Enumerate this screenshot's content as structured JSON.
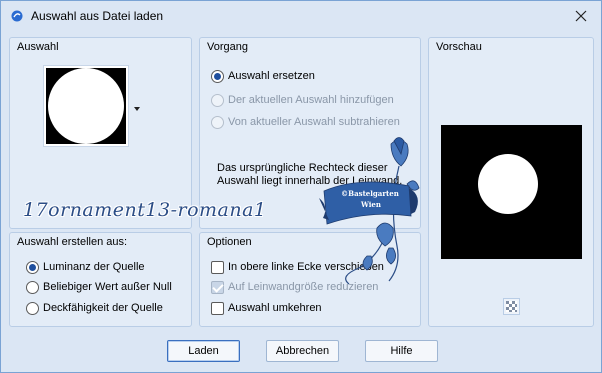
{
  "window": {
    "title": "Auswahl aus Datei laden",
    "close_icon": "close-icon"
  },
  "auswahl": {
    "title": "Auswahl"
  },
  "vorgang": {
    "title": "Vorgang",
    "options": [
      {
        "label": "Auswahl ersetzen",
        "checked": true,
        "disabled": false
      },
      {
        "label": "Der aktuellen Auswahl hinzufügen",
        "checked": false,
        "disabled": true
      },
      {
        "label": "Von aktueller Auswahl subtrahieren",
        "checked": false,
        "disabled": true
      }
    ],
    "info": "Das ursprüngliche Rechteck dieser Auswahl liegt innerhalb der Leinwand."
  },
  "vorschau": {
    "title": "Vorschau",
    "zoom_icon": "checker-icon"
  },
  "erstellen": {
    "title": "Auswahl erstellen aus:",
    "options": [
      {
        "label": "Luminanz der Quelle",
        "checked": true
      },
      {
        "label": "Beliebiger Wert außer Null",
        "checked": false
      },
      {
        "label": "Deckfähigkeit der Quelle",
        "checked": false
      }
    ]
  },
  "optionen": {
    "title": "Optionen",
    "checks": [
      {
        "label": "In obere linke Ecke verschieben",
        "checked": false,
        "disabled": false
      },
      {
        "label": "Auf Leinwandgröße reduzieren",
        "checked": true,
        "disabled": true
      },
      {
        "label": "Auswahl umkehren",
        "checked": false,
        "disabled": false
      }
    ]
  },
  "watermark": {
    "text": "17ornament13-romana1",
    "banner_line1": "©Bastelgarten",
    "banner_line2": "Wien"
  },
  "buttons": {
    "ok": "Laden",
    "cancel": "Abbrechen",
    "help": "Hilfe"
  },
  "colors": {
    "accent": "#1f4f9e",
    "background": "#dbe6f4",
    "watermark": "#2b4d86"
  }
}
